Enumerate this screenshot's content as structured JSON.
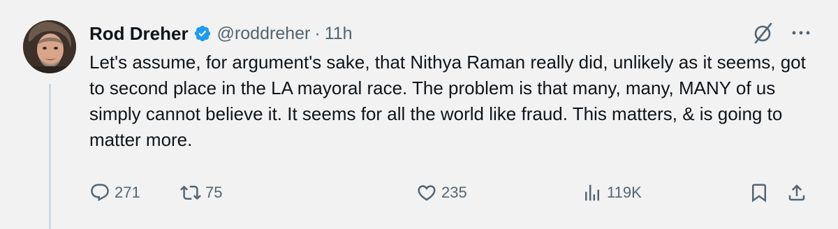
{
  "author": {
    "name": "Rod Dreher",
    "handle": "@roddreher",
    "separator": "·",
    "time": "11h",
    "verified": true
  },
  "tweet": {
    "text": "Let's assume, for argument's sake, that Nithya Raman really did, unlikely as it seems, got to second place in the LA mayoral race. The problem is that many, many, MANY of us simply cannot believe it. It seems for all the world like fraud. This matters, & is going to matter more."
  },
  "metrics": {
    "replies": "271",
    "reposts": "75",
    "likes": "235",
    "views": "119K"
  },
  "colors": {
    "background": "#f2f2f2",
    "text": "#0f1419",
    "secondary": "#536471",
    "verified_badge": "#1d9bf0",
    "thread_line": "#cfd9de"
  },
  "icons": [
    "verified-badge-icon",
    "grok-icon",
    "more-icon",
    "reply-icon",
    "repost-icon",
    "like-icon",
    "views-icon",
    "bookmark-icon",
    "share-icon"
  ]
}
